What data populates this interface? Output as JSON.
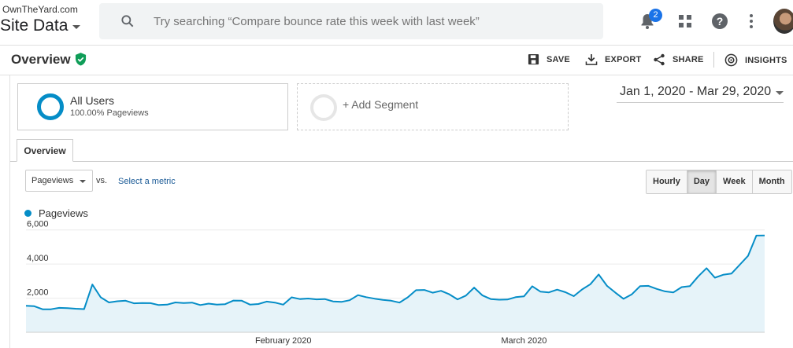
{
  "topbar": {
    "account": "OwnTheYard.com",
    "property": "Site Data",
    "search_placeholder": "Try searching “Compare bounce rate this week with last week”",
    "notification_count": "2"
  },
  "header": {
    "title": "Overview",
    "actions": {
      "save": "SAVE",
      "export": "EXPORT",
      "share": "SHARE",
      "insights": "INSIGHTS"
    }
  },
  "segments": {
    "active": {
      "name": "All Users",
      "detail": "100.00% Pageviews"
    },
    "add_label": "+ Add Segment"
  },
  "date_range": "Jan 1, 2020 - Mar 29, 2020",
  "tabs": {
    "overview": "Overview"
  },
  "metric_selector": {
    "selected": "Pageviews",
    "vs": "vs.",
    "select_metric": "Select a metric"
  },
  "granularity": {
    "options": [
      "Hourly",
      "Day",
      "Week",
      "Month"
    ],
    "selected": "Day"
  },
  "colors": {
    "series": "#058dc7",
    "fill": "#e6f3f9",
    "accent": "#1a73e8",
    "verified": "#0f9d58"
  },
  "chart_data": {
    "type": "area",
    "series": [
      {
        "name": "Pageviews",
        "values": [
          1550,
          1530,
          1350,
          1350,
          1430,
          1420,
          1380,
          1360,
          2800,
          2050,
          1750,
          1820,
          1850,
          1700,
          1720,
          1710,
          1600,
          1620,
          1750,
          1720,
          1740,
          1600,
          1680,
          1620,
          1650,
          1860,
          1850,
          1620,
          1660,
          1800,
          1740,
          1620,
          2050,
          1950,
          1980,
          1930,
          1950,
          1810,
          1780,
          1880,
          2180,
          2060,
          1970,
          1900,
          1850,
          1740,
          2050,
          2470,
          2480,
          2320,
          2430,
          2230,
          1930,
          2150,
          2620,
          2160,
          1950,
          1910,
          1920,
          2060,
          2110,
          2700,
          2380,
          2340,
          2500,
          2350,
          2120,
          2510,
          2820,
          3390,
          2720,
          2330,
          1960,
          2230,
          2710,
          2720,
          2540,
          2400,
          2340,
          2650,
          2710,
          3280,
          3760,
          3200,
          3370,
          3440,
          3960,
          4480,
          5670,
          5680
        ]
      }
    ],
    "x_start": "2020-01-01",
    "x_end": "2020-03-29",
    "x_tick_labels": [
      "February 2020",
      "March 2020"
    ],
    "y_ticks": [
      2000,
      4000,
      6000
    ],
    "y_tick_labels": [
      "2,000",
      "4,000",
      "6,000"
    ],
    "ylim": [
      0,
      7000
    ],
    "grid": true,
    "legend_placement": "top-left"
  }
}
